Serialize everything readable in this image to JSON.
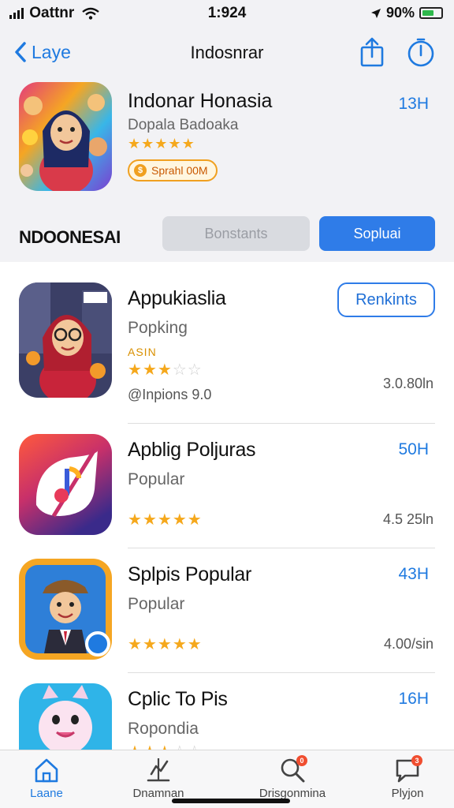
{
  "status_bar": {
    "carrier": "Oattnr",
    "time": "1:924",
    "battery": "90%"
  },
  "nav": {
    "back_label": "Laye",
    "title": "Indosnrar"
  },
  "featured": {
    "title": "Indonar Honasia",
    "subtitle": "Dopala Badoaka",
    "rating": 4.5,
    "badge": "Sprahl 00M",
    "meta": "13H"
  },
  "section": {
    "title": "NDOONESAI",
    "segment_left": "Bonstants",
    "segment_right": "Sopluai"
  },
  "apps": [
    {
      "title": "Appukiaslia",
      "subtitle": "Popking",
      "tag": "ASIN",
      "rating": 2.5,
      "detail": "@Inpions 9.0",
      "button": "Renkints",
      "meta": "3.0.80ln"
    },
    {
      "title": "Apblig Poljuras",
      "subtitle": "Popular",
      "rating": 4.5,
      "meta_top": "50H",
      "meta": "4.5 25ln"
    },
    {
      "title": "Splpis Popular",
      "subtitle": "Popular",
      "rating": 5,
      "meta_top": "43H",
      "meta": "4.00/sin"
    },
    {
      "title": "Cplic To Pis",
      "subtitle": "Ropondia",
      "rating": 3,
      "meta_top": "16H"
    }
  ],
  "tabs": [
    {
      "label": "Laane",
      "icon": "home-icon"
    },
    {
      "label": "Dnamnan",
      "icon": "chart-icon"
    },
    {
      "label": "Drisgonmina",
      "icon": "search-icon",
      "badge": "0"
    },
    {
      "label": "Plyjon",
      "icon": "chat-icon",
      "badge": "3"
    }
  ],
  "colors": {
    "accent": "#1f7ae0",
    "star": "#f5a81c",
    "badge": "#f04e30"
  }
}
